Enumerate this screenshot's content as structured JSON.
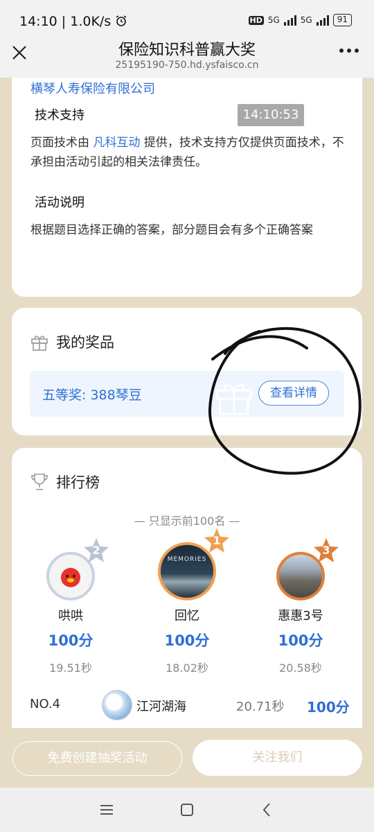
{
  "status_bar": {
    "time": "14:10",
    "speed": "1.0K/s",
    "hd_label": "HD",
    "net1": "5G",
    "net2": "5G",
    "battery": "91",
    "alarm_icon": "alarm-icon"
  },
  "title_bar": {
    "title": "保险知识科普赢大奖",
    "url": "25195190-750.hd.ysfaisco.cn",
    "close_icon": "close-icon",
    "more_icon": "more-icon"
  },
  "info": {
    "company": "横琴人寿保险有限公司",
    "tech_heading": "技术支持",
    "tech_text_pre": "页面技术由 ",
    "tech_link": "凡科互动",
    "tech_text_post": " 提供，技术支持方仅提供页面技术，不承担由活动引起的相关法律责任。",
    "timestamp": "14:10:53",
    "activity_heading": "活动说明",
    "activity_text": "根据题目选择正确的答案，部分题目会有多个正确答案"
  },
  "prizes": {
    "title": "我的奖品",
    "prize": "五等奖: 388琴豆",
    "detail_button": "查看详情",
    "icon": "gift-icon"
  },
  "leaderboard": {
    "title": "排行榜",
    "subtitle": "— 只显示前100名 —",
    "icon": "trophy-icon",
    "top3": [
      {
        "rank": "2",
        "name": "哄哄",
        "score": "100分",
        "time": "19.51秒"
      },
      {
        "rank": "1",
        "name": "回忆",
        "score": "100分",
        "time": "18.02秒",
        "avatar_text": "MEMORIES"
      },
      {
        "rank": "3",
        "name": "惠惠3号",
        "score": "100分",
        "time": "20.58秒"
      }
    ],
    "rows": [
      {
        "no": "NO.4",
        "name": "江河湖海",
        "time": "20.71秒",
        "score": "100分"
      }
    ]
  },
  "actions": {
    "create_button": "免费创建抽奖活动",
    "follow_button": "关注我们"
  },
  "nav": {
    "menu_icon": "menu-icon",
    "home_icon": "home-icon",
    "back_icon": "back-icon"
  },
  "colors": {
    "accent": "#2e6fd6",
    "background": "#e6dcc6",
    "gold": "#f0a050",
    "silver": "#b9c3d6",
    "bronze": "#e0803a"
  }
}
